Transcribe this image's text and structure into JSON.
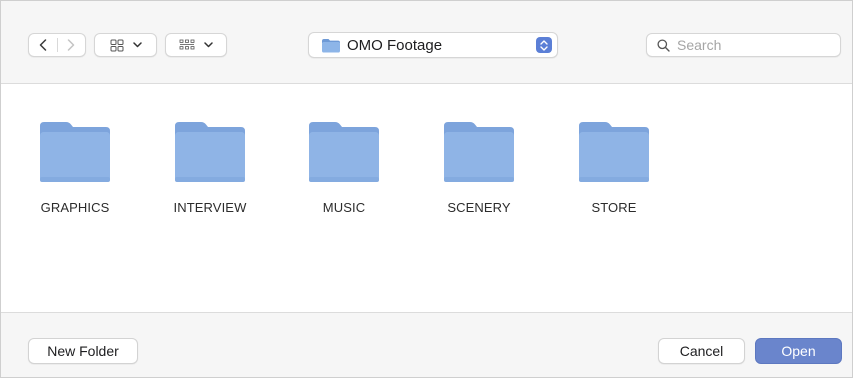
{
  "toolbar": {
    "back_icon": "chevron-left-icon",
    "forward_icon": "chevron-right-icon",
    "view_mode_icon": "icon-grid-icon",
    "group_icon": "group-grid-icon",
    "location": {
      "label": "OMO Footage",
      "icon": "folder-icon"
    },
    "search": {
      "placeholder": "Search",
      "icon": "magnifier-icon"
    }
  },
  "folders": [
    {
      "label": "GRAPHICS"
    },
    {
      "label": "INTERVIEW"
    },
    {
      "label": "MUSIC"
    },
    {
      "label": "SCENERY"
    },
    {
      "label": "STORE"
    }
  ],
  "footer": {
    "new_folder_label": "New Folder",
    "cancel_label": "Cancel",
    "open_label": "Open"
  },
  "colors": {
    "folder_body": "#8fb4e6",
    "folder_tab": "#7da4dc",
    "accent": "#6a85cc"
  }
}
